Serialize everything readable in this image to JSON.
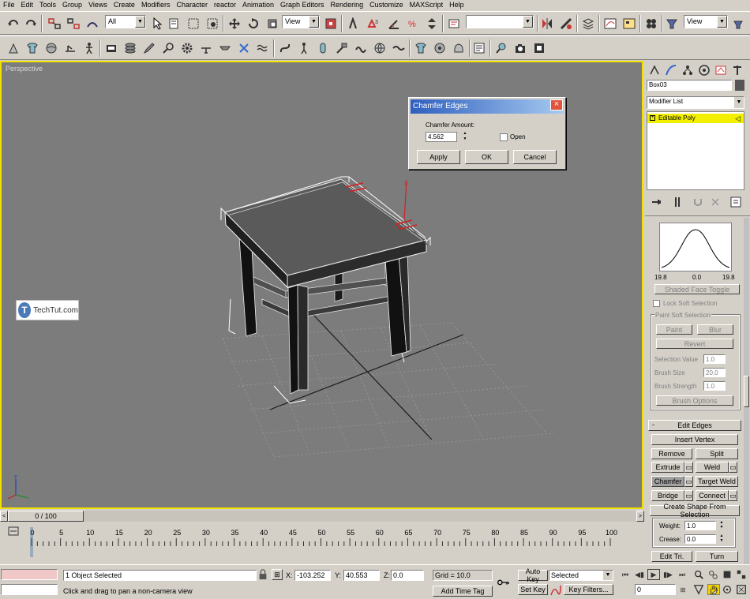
{
  "menu": [
    "File",
    "Edit",
    "Tools",
    "Group",
    "Views",
    "Create",
    "Modifiers",
    "Character",
    "reactor",
    "Animation",
    "Graph Editors",
    "Rendering",
    "Customize",
    "MAXScript",
    "Help"
  ],
  "toolbar": {
    "selection_filter": "All",
    "ref_coord": "View",
    "named_selection": "",
    "view_combo": "View"
  },
  "viewport": {
    "label": "Perspective"
  },
  "dialog": {
    "title": "Chamfer Edges",
    "amount_label": "Chamfer Amount:",
    "amount_value": "4.562",
    "open_label": "Open",
    "apply": "Apply",
    "ok": "OK",
    "cancel": "Cancel"
  },
  "watermark": {
    "logo_letter": "T",
    "text": "TechTut.com"
  },
  "command_panel": {
    "object_name": "Box03",
    "modifier_list": "Modifier List",
    "stack_item": "Editable Poly",
    "curve_left": "19.8",
    "curve_mid": "0.0",
    "curve_right": "19.8",
    "shaded_face_toggle": "Shaded Face Toggle",
    "lock_soft_selection": "Lock Soft Selection",
    "paint_soft_selection": "Paint Soft Selection",
    "paint": "Paint",
    "blur": "Blur",
    "revert": "Revert",
    "selection_value_label": "Selection Value",
    "selection_value": "1.0",
    "brush_size_label": "Brush Size",
    "brush_size": "20.0",
    "brush_strength_label": "Brush Strength",
    "brush_strength": "1.0",
    "brush_options": "Brush Options",
    "rollout_edit_edges": "Edit Edges",
    "rollout_toggle": "-",
    "insert_vertex": "Insert Vertex",
    "remove": "Remove",
    "split": "Split",
    "extrude": "Extrude",
    "weld": "Weld",
    "chamfer": "Chamfer",
    "target_weld": "Target Weld",
    "bridge": "Bridge",
    "connect": "Connect",
    "create_shape": "Create Shape From Selection",
    "weight_label": "Weight:",
    "weight": "1.0",
    "crease_label": "Crease:",
    "crease": "0.0",
    "edit_tri": "Edit Tri.",
    "turn": "Turn"
  },
  "timeline": {
    "frame": "0 / 100",
    "ticks": [
      "0",
      "5",
      "10",
      "15",
      "20",
      "25",
      "30",
      "35",
      "40",
      "45",
      "50",
      "55",
      "60",
      "65",
      "70",
      "75",
      "80",
      "85",
      "90",
      "95",
      "100"
    ]
  },
  "status": {
    "objects_selected": "1 Object Selected",
    "prompt": "Click and drag to pan a non-camera view",
    "x_label": "X:",
    "x_value": "-103.252",
    "y_label": "Y:",
    "y_value": "40.553",
    "z_label": "Z:",
    "z_value": "0.0",
    "grid": "Grid = 10.0",
    "add_time_tag": "Add Time Tag",
    "auto_key": "Auto Key",
    "set_key": "Set Key",
    "selected": "Selected",
    "key_filters": "Key Filters...",
    "current_frame": "0"
  },
  "colors": {
    "viewport_border": "#f2e100",
    "stack_highlight": "#f2f000",
    "viewport_bg": "#7c7c7c"
  }
}
